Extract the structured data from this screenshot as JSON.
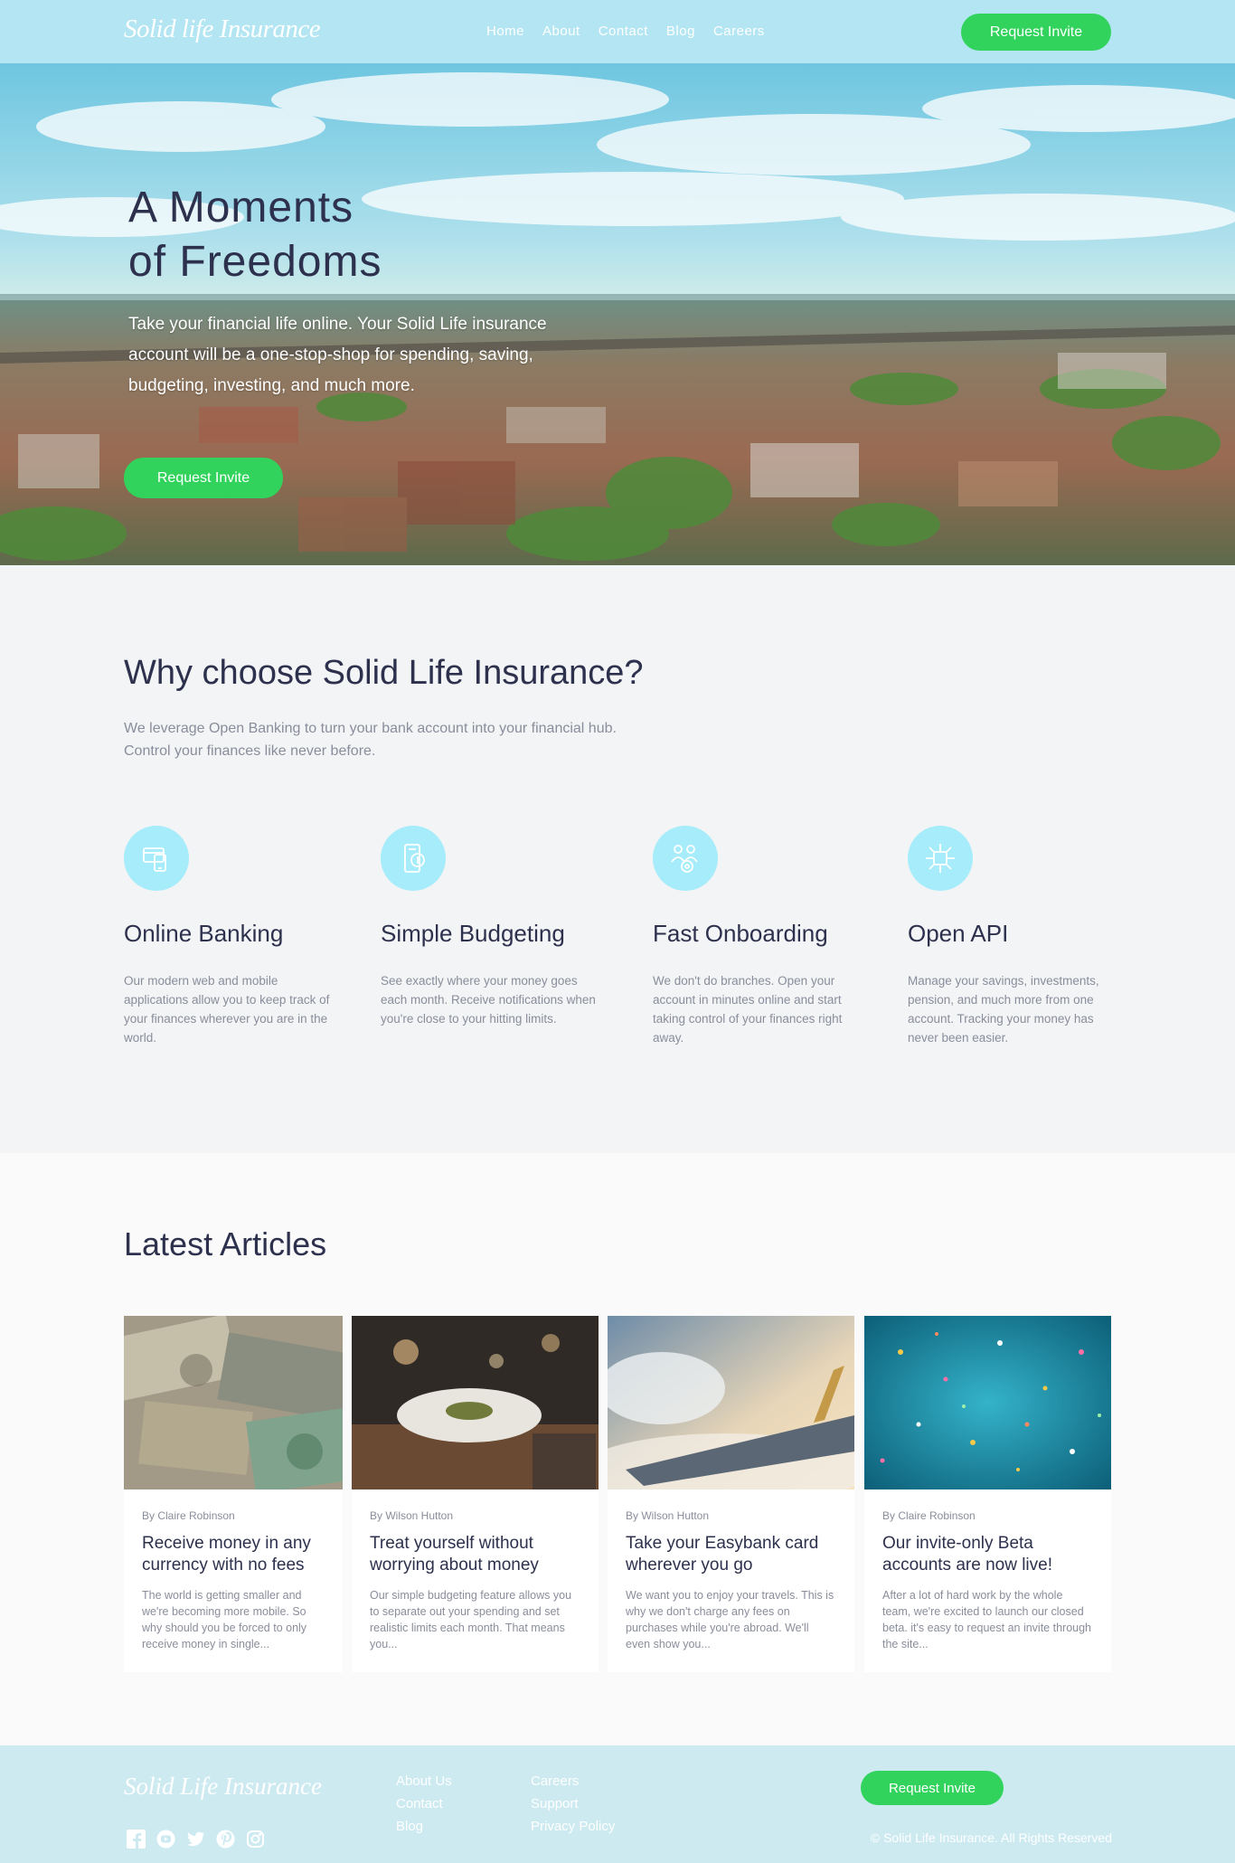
{
  "header": {
    "logo": "Solid life Insurance",
    "nav": [
      "Home",
      "About",
      "Contact",
      "Blog",
      "Careers"
    ],
    "cta": "Request Invite"
  },
  "hero": {
    "title_line1": "A Moments",
    "title_line2": "of Freedoms",
    "text": "Take your financial life online. Your Solid Life insurance account will be a one-stop-shop for spending, saving, budgeting, investing, and much more.",
    "cta": "Request Invite"
  },
  "why": {
    "title": "Why choose Solid Life Insurance?",
    "lead_line1": "We leverage Open Banking to turn your bank account into your financial hub.",
    "lead_line2": "Control your finances like never before.",
    "features": [
      {
        "icon": "online-banking-icon",
        "title": "Online Banking",
        "text": "Our modern web and mobile applications allow you to keep track of your finances wherever you are in the world."
      },
      {
        "icon": "budgeting-icon",
        "title": "Simple Budgeting",
        "text": "See exactly where your money goes each month. Receive notifications when you're close to your hitting limits."
      },
      {
        "icon": "onboarding-icon",
        "title": "Fast Onboarding",
        "text": "We don't do branches. Open your account in minutes online and start taking control of your finances right away."
      },
      {
        "icon": "api-icon",
        "title": "Open API",
        "text": "Manage your savings, investments, pension, and much more from one account. Tracking your money has never been easier."
      }
    ]
  },
  "articles": {
    "title": "Latest Articles",
    "items": [
      {
        "author": "By Claire Robinson",
        "title": "Receive money in any currency with no fees",
        "excerpt": "The world is getting smaller and we're becoming more mobile. So why should you be forced to only receive money in single..."
      },
      {
        "author": "By Wilson Hutton",
        "title": "Treat yourself without worrying about money",
        "excerpt": "Our simple budgeting feature allows you to separate out your spending and set realistic limits each month. That means you..."
      },
      {
        "author": "By Wilson Hutton",
        "title": "Take your Easybank card wherever you go",
        "excerpt": "We want you to enjoy your travels. This is why we don't charge any fees on purchases while you're abroad. We'll even show you..."
      },
      {
        "author": "By Claire Robinson",
        "title": "Our invite-only Beta accounts are now live!",
        "excerpt": "After a lot of hard work by the whole team, we're excited to launch our closed beta. it's easy to request an invite through the site..."
      }
    ]
  },
  "footer": {
    "logo": "Solid Life Insurance",
    "col1": [
      "About Us",
      "Contact",
      "Blog"
    ],
    "col2": [
      "Careers",
      "Support",
      "Privacy Policy"
    ],
    "cta": "Request Invite",
    "copyright": "© Solid Life Insurance. All Rights Reserved",
    "social": [
      "facebook-icon",
      "youtube-icon",
      "twitter-icon",
      "pinterest-icon",
      "instagram-icon"
    ]
  },
  "colors": {
    "header_bg": "#b3e6f2",
    "accent_green": "#31d35c",
    "icon_bg": "#a6ecfa",
    "section_bg": "#f3f4f6",
    "footer_bg": "#cdeaf1",
    "text_dark": "#2d314d",
    "text_muted": "#8a8d9b"
  }
}
